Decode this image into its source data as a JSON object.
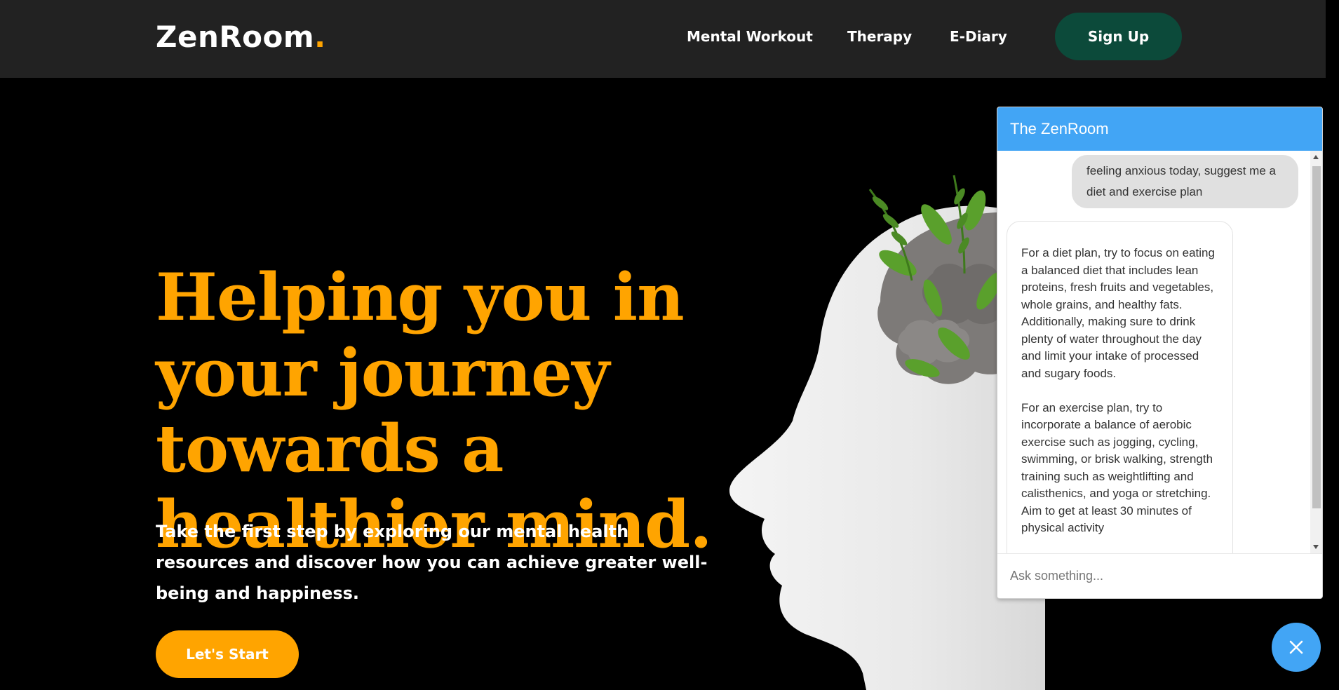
{
  "nav": {
    "logo_text": "ZenRoom",
    "logo_dot": ".",
    "links": [
      "Mental Workout",
      "Therapy",
      "E-Diary"
    ],
    "signup_label": "Sign Up"
  },
  "hero": {
    "title": "Helping you in your journey towards a healthier mind.",
    "subtitle": "Take the first step by exploring our mental health resources and discover how you can achieve greater well-being and happiness.",
    "cta_label": "Let's Start"
  },
  "chat": {
    "title": "The ZenRoom",
    "user_message": "feeling anxious today, suggest me a diet and exercise plan",
    "bot_message": "For a diet plan, try to focus on eating a balanced diet that includes lean proteins, fresh fruits and vegetables, whole grains, and healthy fats. Additionally, making sure to drink plenty of water throughout the day and limit your intake of processed and sugary foods.\n\nFor an exercise plan, try to incorporate a balance of aerobic exercise such as jogging, cycling, swimming, or brisk walking, strength training such as weightlifting and calisthenics, and yoga or stretching. Aim to get at least 30 minutes of physical activity",
    "input_placeholder": "Ask something..."
  },
  "icons": {
    "close": "close-icon"
  },
  "colors": {
    "accent": "#ffa400",
    "nav_bg": "#222222",
    "signup_bg": "#0c4a3a",
    "chat_blue": "#42a5f5"
  }
}
